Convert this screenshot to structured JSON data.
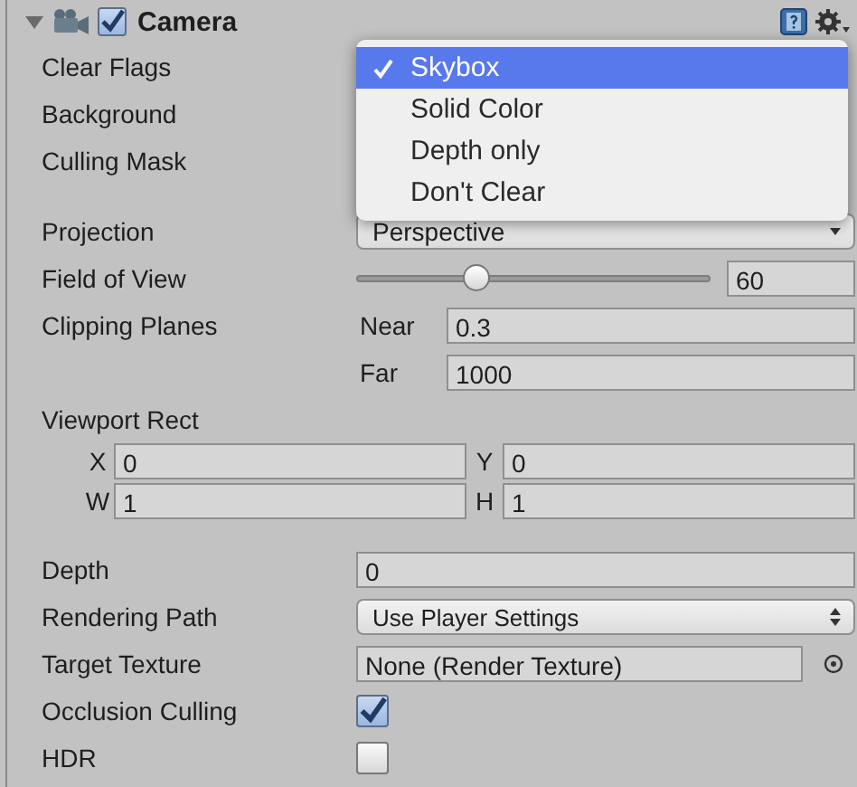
{
  "component": {
    "title": "Camera",
    "expanded": true,
    "enabled": true
  },
  "properties": [
    {
      "kind": "covered",
      "label": "Clear Flags"
    },
    {
      "kind": "covered",
      "label": "Background"
    },
    {
      "kind": "covered",
      "label": "Culling Mask"
    },
    {
      "kind": "gap"
    },
    {
      "kind": "dropdown",
      "label": "Projection",
      "value": "Perspective"
    },
    {
      "kind": "slider",
      "label": "Field of View",
      "level": 0.34,
      "value": "60"
    },
    {
      "kind": "pair",
      "label": "Clipping Planes",
      "fields": [
        {
          "label": "Near",
          "value": "0.3"
        },
        {
          "label": "Far",
          "value": "1000"
        }
      ]
    },
    {
      "kind": "heading",
      "label": "Viewport Rect"
    },
    {
      "kind": "grid",
      "fields": [
        {
          "label": "X",
          "value": "0"
        },
        {
          "label": "Y",
          "value": "0"
        },
        {
          "label": "W",
          "value": "1"
        },
        {
          "label": "H",
          "value": "1"
        }
      ]
    },
    {
      "kind": "gap"
    },
    {
      "kind": "text",
      "label": "Depth",
      "value": "0"
    },
    {
      "kind": "popup",
      "label": "Rendering Path",
      "value": "Use Player Settings"
    },
    {
      "kind": "object",
      "label": "Target Texture",
      "value": "None (Render Texture)"
    },
    {
      "kind": "checkbox",
      "label": "Occlusion Culling",
      "checked": true
    },
    {
      "kind": "checkbox",
      "label": "HDR",
      "checked": false
    }
  ],
  "menu": {
    "items": [
      {
        "label": "Skybox",
        "selected": true
      },
      {
        "label": "Solid Color",
        "selected": false
      },
      {
        "label": "Depth only",
        "selected": false
      },
      {
        "label": "Don't Clear",
        "selected": false
      }
    ]
  }
}
